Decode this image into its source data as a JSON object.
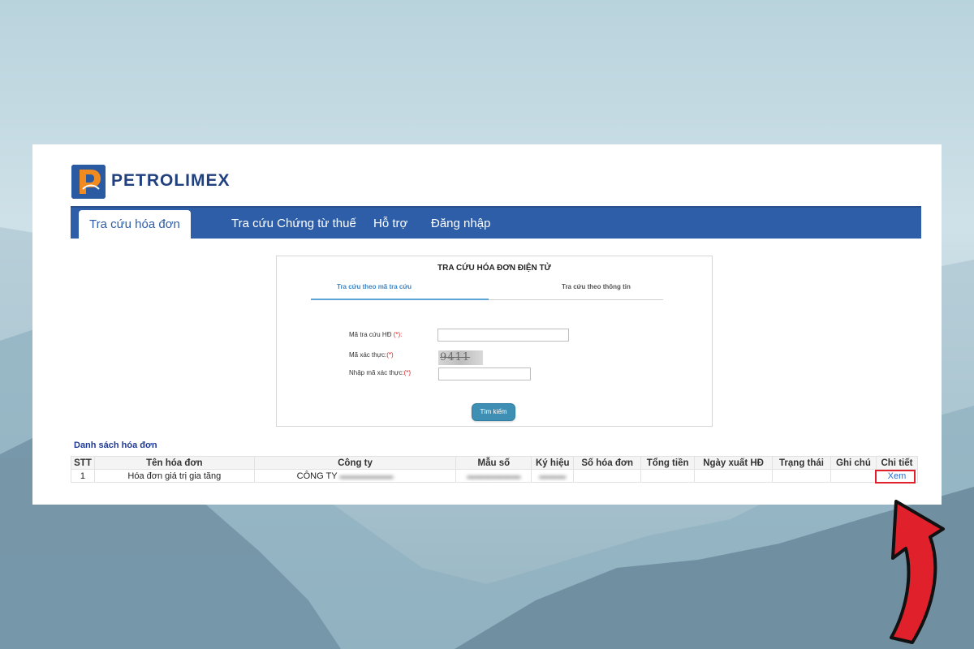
{
  "brand": {
    "name": "PETROLIMEX",
    "color": "#2f5ea8",
    "logo_icon": "petrolimex-logo-icon"
  },
  "nav": {
    "items": [
      {
        "label": "Tra cứu hóa đơn",
        "active": true
      },
      {
        "label": "Tra cứu Chứng từ thuế",
        "active": false
      },
      {
        "label": "Hỗ trợ",
        "active": false
      },
      {
        "label": "Đăng nhập",
        "active": false
      }
    ]
  },
  "search": {
    "title": "TRA CỨU HÓA ĐƠN ĐIỆN TỬ",
    "tabs": [
      {
        "label": "Tra cứu theo mã tra cứu",
        "active": true
      },
      {
        "label": "Tra cứu theo thông tin",
        "active": false
      }
    ],
    "lookup_label": "Mã tra cứu HĐ ",
    "lookup_req": "(*):",
    "lookup_value": "",
    "captcha_label": "Mã xác thực:",
    "captcha_req": "(*)",
    "captcha_image_text": "9411",
    "captcha_input_label": "Nhập mã xác thực:",
    "captcha_input_req": "(*)",
    "captcha_input_value": "",
    "button_label": "Tìm kiếm"
  },
  "invoices": {
    "title": "Danh sách hóa đơn",
    "columns": [
      "STT",
      "Tên hóa đơn",
      "Công ty",
      "Mẫu số",
      "Ký hiệu",
      "Số hóa đơn",
      "Tổng tiền",
      "Ngày xuất HĐ",
      "Trạng thái",
      "Ghi chú",
      "Chi tiết"
    ],
    "rows": [
      {
        "stt": "1",
        "name": "Hóa đơn giá trị gia tăng",
        "company": "CÔNG TY",
        "form_no": "",
        "symbol": "",
        "invoice_no": "",
        "total": "",
        "issue_date": "",
        "status": "",
        "note": "",
        "detail": "Xem"
      }
    ]
  },
  "highlight_color": "#e0202a"
}
